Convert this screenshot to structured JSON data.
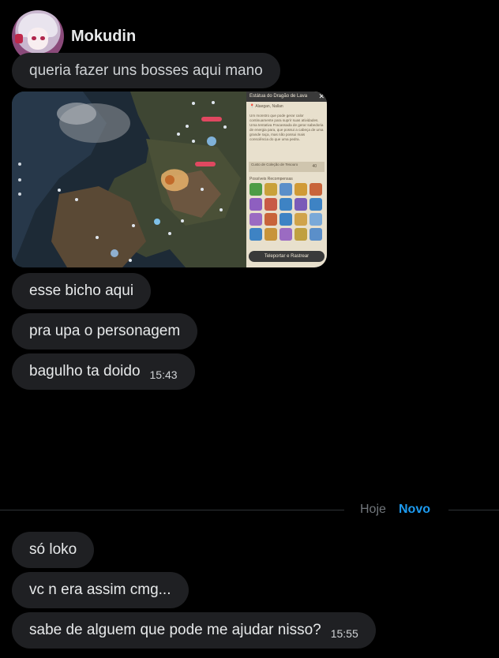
{
  "sender": {
    "name": "Mokudin"
  },
  "messages_before": [
    {
      "text": "queria fazer uns bosses aqui mano",
      "time": ""
    },
    {
      "text": "esse bicho aqui",
      "time": ""
    },
    {
      "text": "pra upa o personagem",
      "time": ""
    },
    {
      "text": "bagulho ta doido",
      "time": "15:43"
    }
  ],
  "attachment": {
    "panel_title": "Estátua do Dragão de Lava",
    "location": "Alaegan, Nallan",
    "description": "Um monstro que pode gerar calor continuamente para suprir suas atividades. Uma tentativa Fracassada de gerar sabedoria de energia para, que possui a cabeça de uma grande raça, mas não possui mais consciência do que uma pedra.",
    "cost_label": "Custo de Coleção de Tesouro",
    "cost_value": "40",
    "rewards_label": "Possíveis Recompensas",
    "teleport_label": "Teleportar e Rastrear",
    "map_tags": [
      "Disponível",
      "Disponível",
      "Disponível"
    ],
    "reward_colors": [
      "#4d9c46",
      "#c9a13a",
      "#5b8fc9",
      "#d09a36",
      "#c8643a",
      "#8e5fc0",
      "#c85a46",
      "#3e83c4",
      "#7a5bb8",
      "#3e83c4",
      "#9b6bc2",
      "#c8643a",
      "#3e83c4",
      "#d0a34a",
      "#7aa9d8",
      "#3e83c4",
      "#c8943a",
      "#9b6bc2",
      "#c0a040",
      "#5b8fc9"
    ]
  },
  "divider": {
    "today_label": "Hoje",
    "new_label": "Novo"
  },
  "messages_after": [
    {
      "text": "só loko",
      "time": ""
    },
    {
      "text": "vc n era assim cmg...",
      "time": ""
    },
    {
      "text": "sabe de alguem que pode me ajudar nisso?",
      "time": "15:55"
    }
  ]
}
